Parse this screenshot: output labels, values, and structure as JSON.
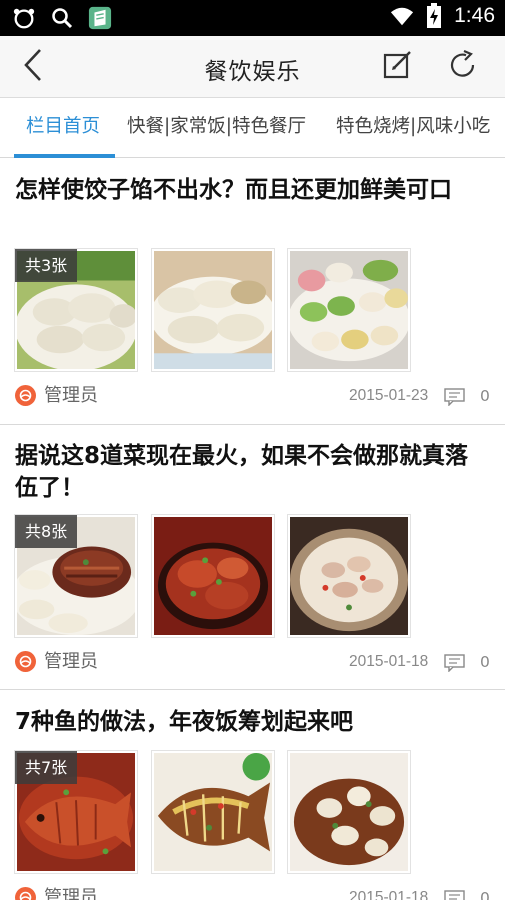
{
  "status_bar": {
    "time": "1:46",
    "icons": [
      "app-circle-icon",
      "search-icon",
      "app-notebook-icon",
      "wifi-icon",
      "battery-charging-icon"
    ]
  },
  "header": {
    "title": "餐饮娱乐",
    "back_icon": "chevron-left-icon",
    "edit_icon": "edit-icon",
    "refresh_icon": "refresh-icon"
  },
  "tabs": [
    {
      "label": "栏目首页",
      "active": true
    },
    {
      "label": "快餐|家常饭|特色餐厅",
      "active": false
    },
    {
      "label": "特色烧烤|风味小吃",
      "active": false
    }
  ],
  "colors": {
    "accent": "#2c8fd6",
    "avatar": "#f0633a"
  },
  "articles": [
    {
      "title": "怎样使饺子馅不出水？而且还更加鲜美可口",
      "image_count_label": "共3张",
      "author": "管理员",
      "date": "2015-01-23",
      "comments": "0"
    },
    {
      "title": "据说这8道菜现在最火，如果不会做那就真落伍了！",
      "image_count_label": "共8张",
      "author": "管理员",
      "date": "2015-01-18",
      "comments": "0"
    },
    {
      "title": "7种鱼的做法，年夜饭筹划起来吧",
      "image_count_label": "共7张",
      "author": "管理员",
      "date": "2015-01-18",
      "comments": "0"
    }
  ]
}
